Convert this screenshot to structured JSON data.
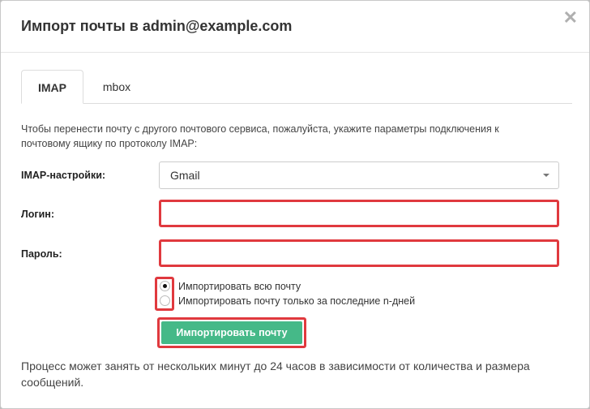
{
  "dialog": {
    "title": "Импорт почты в admin@example.com",
    "close_glyph": "✕",
    "close_icon": "close-icon"
  },
  "tabs": [
    {
      "label": "IMAP",
      "active": true
    },
    {
      "label": "mbox",
      "active": false
    }
  ],
  "description": "Чтобы перенести почту с другого почтового сервиса, пожалуйста, укажите параметры подключения к почтовому ящику по протоколу IMAP:",
  "form": {
    "imap_label": "IMAP-настройки:",
    "imap_selected": "Gmail",
    "login_label": "Логин:",
    "login_value": "",
    "password_label": "Пароль:",
    "password_value": ""
  },
  "radios": [
    {
      "label": "Импортировать всю почту",
      "checked": true
    },
    {
      "label": "Импортировать почту только за последние n-дней",
      "checked": false
    }
  ],
  "submit_label": "Импортировать почту",
  "footer_note": "Процесс может занять от нескольких минут до 24 часов в зависимости от количества и размера сообщений.",
  "colors": {
    "accent_button": "#45b988",
    "highlight": "#e0393e"
  }
}
